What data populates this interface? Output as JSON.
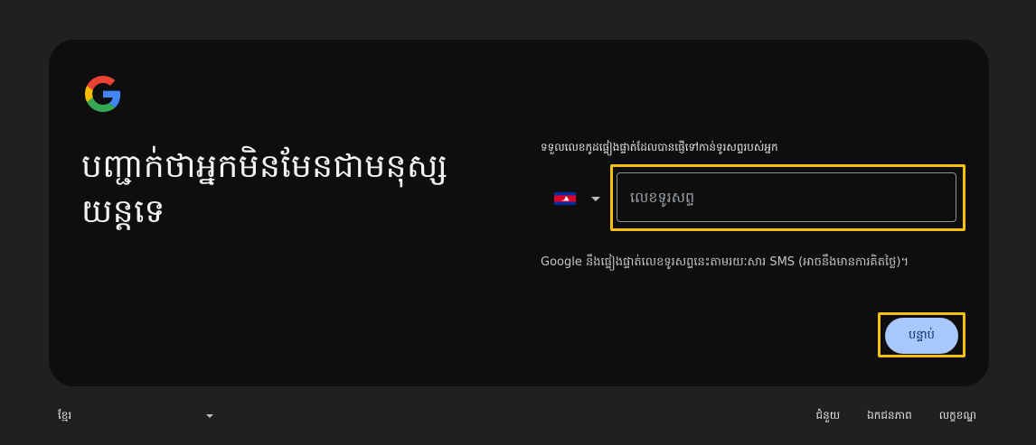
{
  "logo": {
    "icon": "google-g-logo-icon"
  },
  "title": "បញ្ជាក់ថាអ្នកមិនមែនជាមនុស្សយន្តទេ",
  "instruction": "ទទួលលេខកូដផ្ទៀងផ្ទាត់ដែលបានផ្ញើទៅកាន់ទូរសព្ទរបស់អ្នក",
  "country": {
    "icon": "cambodia-flag-icon"
  },
  "phone_input": {
    "placeholder": "លេខទូរសព្ទ",
    "value": ""
  },
  "sms_note": "Google នឹងផ្ទៀងផ្ទាត់លេខទូរសព្ទនេះតាមរយៈសារ SMS (អាចនឹងមានការគិតថ្លៃ)។",
  "next_button": {
    "label": "បន្ទាប់"
  },
  "footer": {
    "language": "ខ្មែរ",
    "links": [
      "ជំនួយ",
      "ឯកជនភាព",
      "លក្ខខណ្ឌ"
    ]
  },
  "colors": {
    "page_bg": "#1f2022",
    "card_bg": "#0e0e0e",
    "highlight": "#f4c20d",
    "button_bg": "#a8c7fa",
    "button_text": "#062e6f"
  }
}
